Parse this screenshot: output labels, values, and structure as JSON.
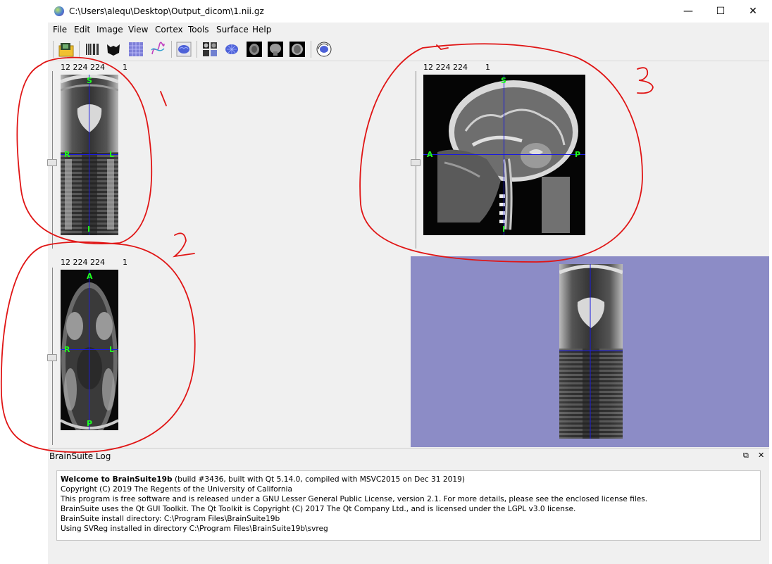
{
  "window": {
    "title": "C:\\Users\\alequ\\Desktop\\Output_dicom\\1.nii.gz",
    "controls": {
      "minimize": "—",
      "maximize": "☐",
      "close": "✕"
    }
  },
  "menu": [
    "File",
    "Edit",
    "Image",
    "View",
    "Cortex",
    "Tools",
    "Surface",
    "Help"
  ],
  "toolbar_icons": [
    "open-volume-icon",
    "barcode-icon",
    "mask-icon",
    "grid-icon",
    "curves-icon",
    "brain-surface-icon",
    "slice-layout-icon",
    "brain-mesh-icon",
    "axial-brain-icon",
    "coronal-brain-icon",
    "sagittal-brain-icon",
    "rotate-brain-icon"
  ],
  "views": {
    "coronal": {
      "info": "12 224 224",
      "slice": "1",
      "labels": {
        "top": "S",
        "left": "R",
        "right": "L",
        "bottom": "I"
      }
    },
    "axial": {
      "info": "12 224 224",
      "slice": "1",
      "labels": {
        "top": "A",
        "left": "R",
        "right": "L",
        "bottom": "P"
      }
    },
    "sagittal": {
      "info": "12 224 224",
      "slice": "1",
      "labels": {
        "top": "S",
        "left": "A",
        "right": "P",
        "bottom": "I"
      }
    }
  },
  "annotations": [
    "1",
    "2",
    "3"
  ],
  "log": {
    "title": "BrainSuite Log",
    "welcome_bold": "Welcome to BrainSuite19b",
    "welcome_rest": " (build #3436, built with Qt 5.14.0, compiled with MSVC2015 on Dec 31 2019)",
    "lines": [
      "Copyright (C) 2019 The Regents of the University of California",
      "This program is free software and is released under a GNU Lesser General Public License, version 2.1. For more details, please see the enclosed license files.",
      "BrainSuite uses the Qt GUI Toolkit. The Qt Toolkit is Copyright (C) 2017 The Qt Company Ltd., and is licensed under the LGPL v3.0 license.",
      "BrainSuite install directory: C:\\Program Files\\BrainSuite19b",
      "Using SVReg installed in directory C:\\Program Files\\BrainSuite19b\\svreg"
    ],
    "dock_buttons": {
      "float": "⧉",
      "close": "✕"
    }
  },
  "colors": {
    "background3d": "#8c8cc6",
    "crosshair": "#1a1ae0",
    "orientation": "#1eff1e",
    "annotation": "#e01515"
  }
}
